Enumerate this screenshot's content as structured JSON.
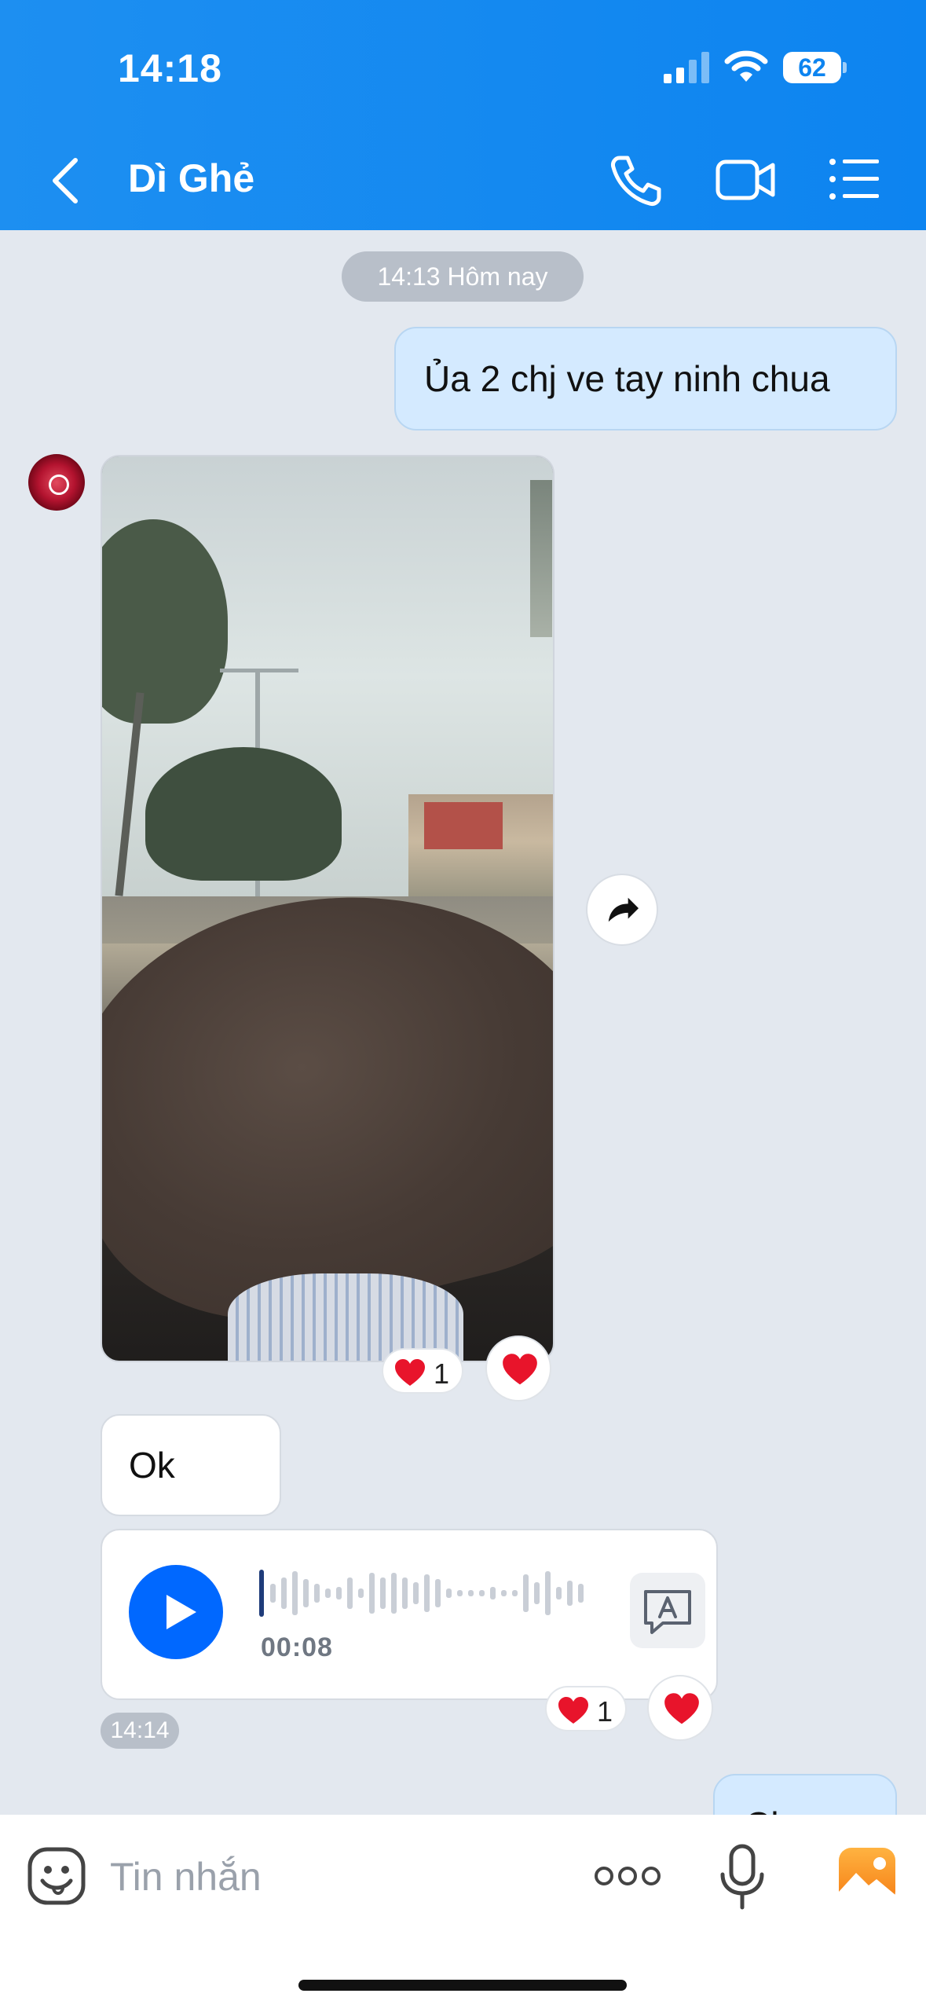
{
  "status_bar": {
    "time": "14:18",
    "battery": "62"
  },
  "header": {
    "title": "Dì Ghẻ"
  },
  "conversation": {
    "date_separator": "14:13 Hôm nay",
    "outgoing_message_1": "Ủa 2 chj ve tay ninh chua",
    "video_reactions": {
      "heart_count": "1"
    },
    "incoming_text": "Ok",
    "voice_message": {
      "duration": "00:08",
      "progress": 0.0
    },
    "voice_reactions": {
      "heart_count": "1"
    },
    "timestamp": "14:14",
    "outgoing_partial": "Ch..."
  },
  "composer": {
    "placeholder": "Tin nhắn"
  },
  "colors": {
    "header": "#0d84f0",
    "accent": "#0068ff",
    "heart": "#e8142b",
    "outgoing_bubble": "#d4eaff"
  }
}
